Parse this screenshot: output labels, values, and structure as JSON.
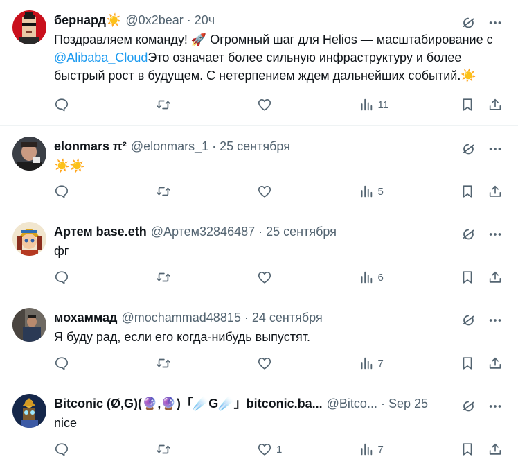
{
  "tweets": [
    {
      "name": "бернард☀️",
      "handle": "@0x2bear",
      "time": "20ч",
      "text_before": "Поздравляем команду! 🚀 Огромный шаг для Helios — масштабирование с ",
      "mention": "@Alibaba_Cloud",
      "text_after": "Это означает более сильную инфраструктуру и более быстрый рост в будущем. С нетерпением ждем дальнейших событий.☀️",
      "likes": "",
      "views": "11"
    },
    {
      "name": "elonmars π²",
      "handle": "@elonmars_1",
      "time": "25 сентября",
      "text": "☀️☀️",
      "likes": "",
      "views": "5"
    },
    {
      "name": "Артем base.eth",
      "handle": "@Артем32846487",
      "time": "25 сентября",
      "text": "фг",
      "likes": "",
      "views": "6"
    },
    {
      "name": "мохаммад",
      "handle": "@mochammad48815",
      "time": "24 сентября",
      "text": "Я буду рад, если его когда-нибудь выпустят.",
      "likes": "",
      "views": "7"
    },
    {
      "name": "Bitconic (Ø,G)(🔮,🔮)「☄️G☄️」bitconic.ba...",
      "handle": "@Bitco...",
      "time": "Sep 25",
      "text": "nice",
      "likes": "1",
      "views": "7"
    }
  ],
  "colors": {
    "text": "#0f1419",
    "secondary": "#536471",
    "link": "#1d9bf0",
    "divider": "#eff3f4"
  },
  "icons": [
    "grok-icon",
    "more-icon",
    "reply-icon",
    "retweet-icon",
    "like-icon",
    "views-icon",
    "bookmark-icon",
    "share-icon"
  ]
}
